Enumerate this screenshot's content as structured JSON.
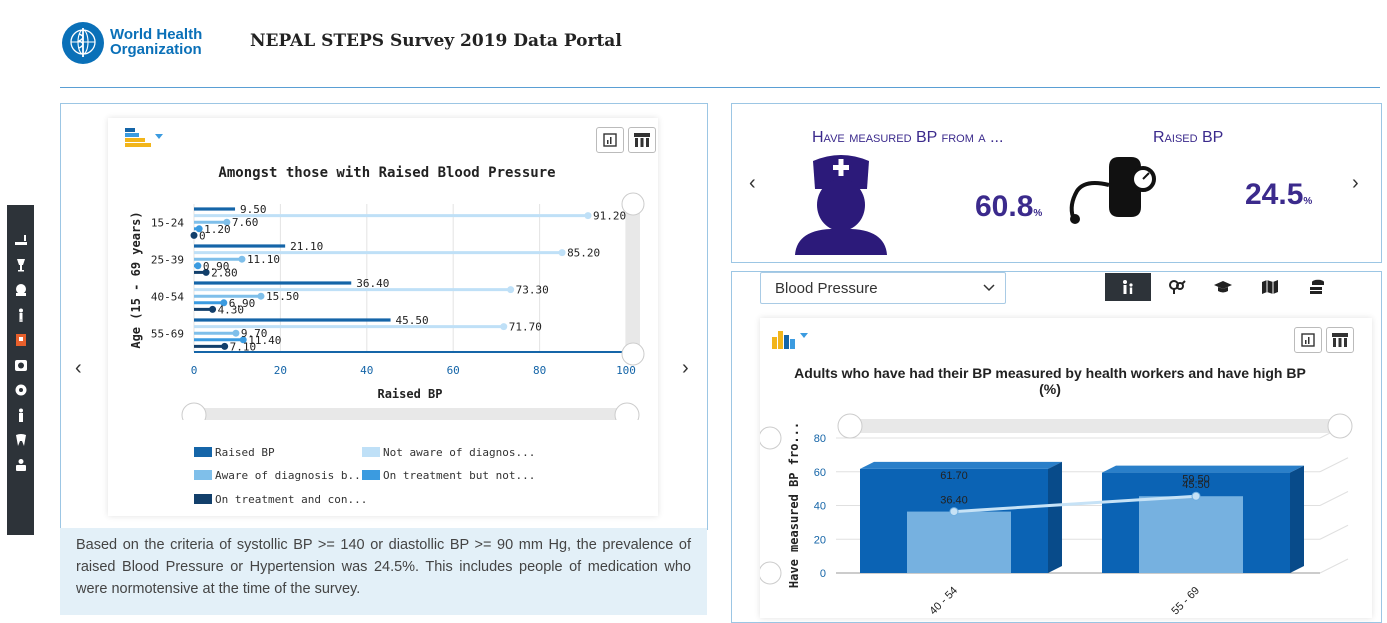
{
  "header": {
    "logo_line1": "World Health",
    "logo_line2": "Organization",
    "title": "NEPAL STEPS Survey 2019 Data Portal"
  },
  "sidebar": {
    "icons": [
      "tobacco-icon",
      "alcohol-icon",
      "diet-icon",
      "physical-activity-icon",
      "bmi-icon",
      "blood-pressure-icon",
      "glucose-icon",
      "cholesterol-icon",
      "oral-health-icon",
      "cvd-risk-icon"
    ]
  },
  "left_chart": {
    "chart_data": {
      "type": "bar",
      "title": "Amongst those with Raised Blood Pressure",
      "xlabel": "Raised BP",
      "ylabel": "Age (15 - 69 years)",
      "xlim": [
        0,
        100
      ],
      "x_ticks": [
        "0",
        "20",
        "40",
        "60",
        "80",
        "100"
      ],
      "categories": [
        "15-24",
        "25-39",
        "40-54",
        "55-69"
      ],
      "series": [
        {
          "name": "Raised BP",
          "color": "#1565a8",
          "style": "bar",
          "values": [
            9.5,
            21.1,
            36.4,
            45.5
          ]
        },
        {
          "name": "Not aware of diagnos...",
          "color": "#bfe0f7",
          "style": "lollipop",
          "values": [
            91.2,
            85.2,
            73.3,
            71.7
          ]
        },
        {
          "name": "Aware of diagnosis b...",
          "color": "#7fbfea",
          "style": "lollipop",
          "values": [
            7.6,
            11.1,
            15.5,
            9.7
          ]
        },
        {
          "name": "On treatment but not...",
          "color": "#3b9be0",
          "style": "lollipop",
          "values": [
            1.2,
            0.9,
            6.9,
            11.4
          ]
        },
        {
          "name": "On treatment and con...",
          "color": "#123f6b",
          "style": "lollipop",
          "values": [
            0,
            2.8,
            4.3,
            7.1
          ]
        }
      ],
      "data_labels": [
        [
          "9.50",
          "91.20",
          "7.60",
          "1.20",
          "0"
        ],
        [
          "21.10",
          "85.20",
          "11.10",
          "0.90",
          "2.80"
        ],
        [
          "36.40",
          "73.30",
          "15.50",
          "6.90",
          "4.30"
        ],
        [
          "45.50",
          "71.70",
          "9.70",
          "11.40",
          "7.10"
        ]
      ],
      "grid": true,
      "legend_position": "bottom"
    },
    "legend": [
      "Raised BP",
      "Not aware of diagnos...",
      "Aware of diagnosis b...",
      "On treatment but not...",
      "On treatment and con..."
    ]
  },
  "description": "Based on the criteria of systollic BP >= 140 or diastollic BP >= 90 mm Hg, the prevalence of raised Blood Pressure or Hypertension was 24.5%. This includes people of medication who were normotensive at the time of the survey.",
  "kpi": [
    {
      "title": "Have measured BP from a ...",
      "value": "60.8",
      "unit": "%",
      "icon": "nurse-icon"
    },
    {
      "title": "Raised BP",
      "value": "24.5",
      "unit": "%",
      "icon": "bp-monitor-icon"
    }
  ],
  "filter": {
    "select_value": "Blood Pressure",
    "buttons": [
      "age-group-icon",
      "gender-icon",
      "education-icon",
      "region-icon",
      "wealth-icon"
    ],
    "active": "age-group-icon"
  },
  "right_chart": {
    "chart_data": {
      "type": "bar",
      "title": "Adults who have had their BP measured by health workers and have high BP (%)",
      "ylabel": "Have measured BP fro...",
      "ylim": [
        0,
        80
      ],
      "y_ticks": [
        "0",
        "20",
        "40",
        "60",
        "80"
      ],
      "categories": [
        "40 - 54",
        "55 - 69"
      ],
      "series": [
        {
          "name": "Have measured BP",
          "color": "#0b63b4",
          "style": "bar3d",
          "values": [
            61.7,
            59.5
          ],
          "labels": [
            "61.70",
            "59.50"
          ]
        },
        {
          "name": "Raised BP",
          "color": "#6faedf",
          "style": "line",
          "values": [
            36.4,
            45.5
          ],
          "labels": [
            "36.40",
            "45.50"
          ]
        }
      ],
      "grid": true
    }
  }
}
